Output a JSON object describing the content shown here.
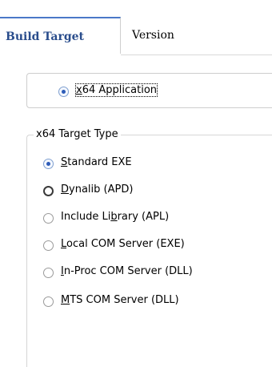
{
  "tabs": [
    {
      "label": "Build Target",
      "active": true
    },
    {
      "label": "Version",
      "active": false
    }
  ],
  "application": {
    "option_label": "x64 Application",
    "accelerator_index": 0,
    "checked": true
  },
  "target_type": {
    "legend": "x64 Target Type",
    "options": [
      {
        "label": "Standard EXE",
        "accel_index": 0,
        "checked": true
      },
      {
        "label": "Dynalib (APD)",
        "accel_index": 0,
        "checked": false
      },
      {
        "label": "Include Library (APL)",
        "accel_index": 10,
        "checked": false
      },
      {
        "label": "Local COM Server (EXE)",
        "accel_index": 0,
        "checked": false
      },
      {
        "label": "In-Proc COM Server (DLL)",
        "accel_index": 0,
        "checked": false
      },
      {
        "label": "MTS COM Server (DLL)",
        "accel_index": 0,
        "checked": false
      }
    ]
  },
  "colors": {
    "active_tab_text": "#2a4d8c",
    "radio_checked_dot": "#2e5cb8",
    "border": "#cdcdcd"
  }
}
